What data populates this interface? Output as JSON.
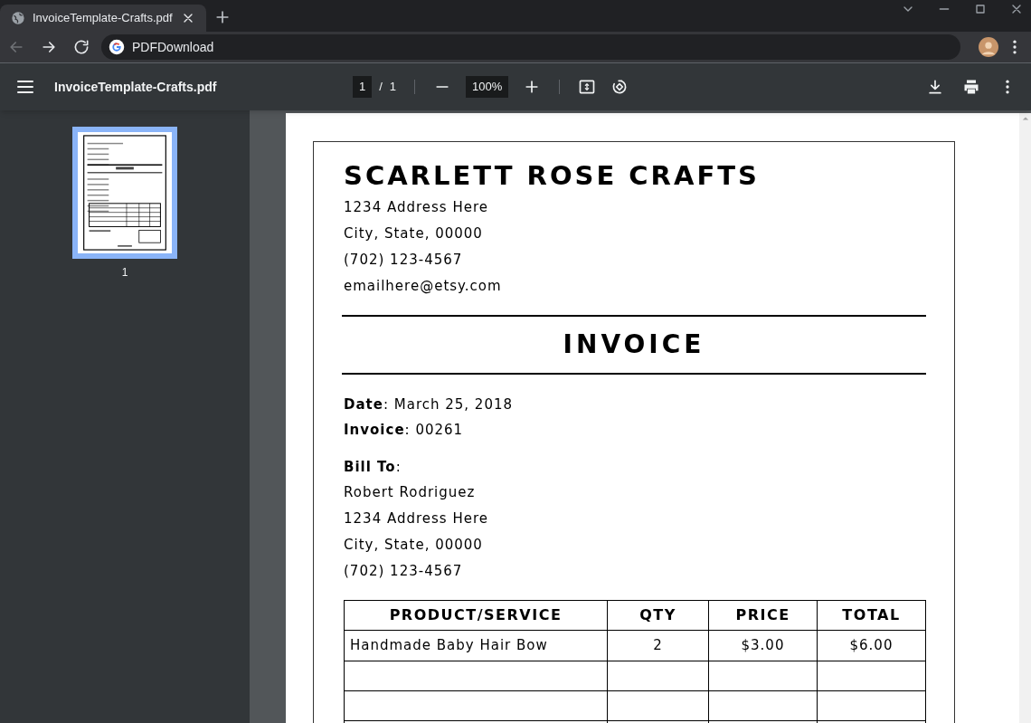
{
  "browser": {
    "tab_title": "InvoiceTemplate-Crafts.pdf",
    "address": "PDFDownload"
  },
  "pdf_toolbar": {
    "file_name": "InvoiceTemplate-Crafts.pdf",
    "page": "1",
    "page_separator": "/",
    "page_count": "1",
    "zoom": "100%"
  },
  "sidebar": {
    "thumbnails": [
      {
        "label": "1",
        "selected": true
      }
    ]
  },
  "document": {
    "company": "SCARLETT ROSE CRAFTS",
    "sender_lines": [
      "1234 Address Here",
      "City, State, 00000",
      "(702) 123-4567",
      "emailhere@etsy.com"
    ],
    "heading": "INVOICE",
    "meta_lines": [
      "**Date**: March 25, 2018",
      "**Invoice**: 00261"
    ],
    "bill_to_label": "**Bill To**:",
    "bill_to_lines": [
      "Robert Rodriguez",
      "1234 Address Here",
      "City, State, 00000",
      "(702) 123-4567"
    ],
    "table": {
      "columns": [
        "PRODUCT/SERVICE",
        "QTY",
        "PRICE",
        "TOTAL"
      ],
      "rows": [
        {
          "cells": [
            "Handmade Baby Hair Bow",
            "2",
            "$3.00",
            "$6.00"
          ]
        }
      ]
    }
  }
}
